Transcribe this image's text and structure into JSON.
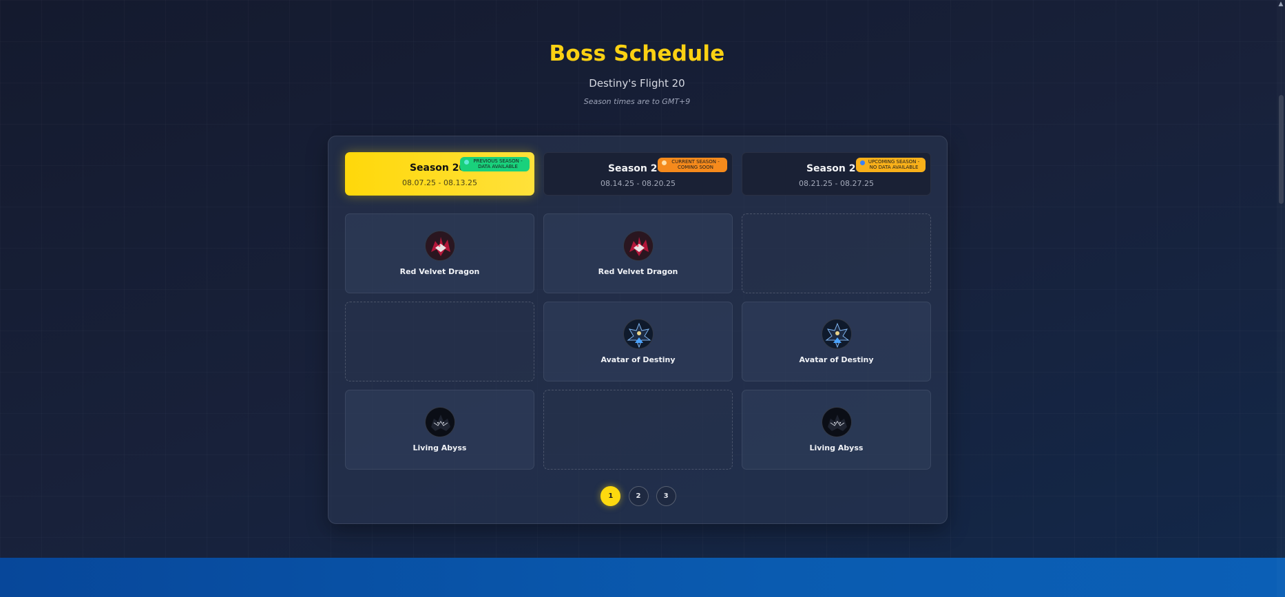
{
  "header": {
    "title": "Boss Schedule",
    "subtitle": "Destiny's Flight 20",
    "note": "Season times are to GMT+9"
  },
  "seasons": [
    {
      "name": "Season 20-",
      "dates": "08.07.25 - 08.13.25",
      "badge_line1": "Previous Season -",
      "badge_line2": "Data Available",
      "status_color": "#19d17c",
      "active": true
    },
    {
      "name": "Season 20-",
      "dates": "08.14.25 - 08.20.25",
      "badge_line1": "Current Season -",
      "badge_line2": "Coming Soon",
      "status_color": "#f58a1c",
      "active": false
    },
    {
      "name": "Season 20-",
      "dates": "08.21.25 - 08.27.25",
      "badge_line1": "Upcoming Season -",
      "badge_line2": "No Data Available",
      "status_color": "#f8b01a",
      "active": false
    }
  ],
  "bosses": [
    {
      "name": "Red Velvet Dragon",
      "icon": "red-velvet-dragon-icon"
    },
    {
      "name": "Red Velvet Dragon",
      "icon": "red-velvet-dragon-icon"
    },
    {
      "name": "",
      "icon": ""
    },
    {
      "name": "",
      "icon": ""
    },
    {
      "name": "Avatar of Destiny",
      "icon": "avatar-of-destiny-icon"
    },
    {
      "name": "Avatar of Destiny",
      "icon": "avatar-of-destiny-icon"
    },
    {
      "name": "Living Abyss",
      "icon": "living-abyss-icon"
    },
    {
      "name": "",
      "icon": ""
    },
    {
      "name": "Living Abyss",
      "icon": "living-abyss-icon"
    }
  ],
  "pagination": {
    "pages": [
      "1",
      "2",
      "3"
    ],
    "current": "1"
  },
  "colors": {
    "accent": "#fdd90f",
    "background": "#18213a",
    "band": "#0a5bb0"
  }
}
